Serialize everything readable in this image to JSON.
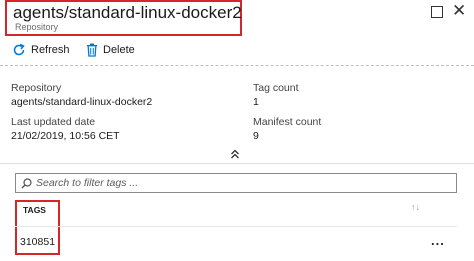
{
  "header": {
    "title": "agents/standard-linux-docker2",
    "subtitle": "Repository"
  },
  "toolbar": {
    "refresh_label": "Refresh",
    "delete_label": "Delete"
  },
  "essentials": {
    "repository_label": "Repository",
    "repository_value": "agents/standard-linux-docker2",
    "last_updated_label": "Last updated date",
    "last_updated_value": "21/02/2019, 10:56 CET",
    "tag_count_label": "Tag count",
    "tag_count_value": "1",
    "manifest_count_label": "Manifest count",
    "manifest_count_value": "9"
  },
  "search": {
    "placeholder": "Search to filter tags ..."
  },
  "table": {
    "columns": [
      "TAGS"
    ],
    "rows": [
      {
        "tag": "310851"
      }
    ]
  },
  "icons": {
    "refresh": "refresh-icon",
    "delete": "trash-icon",
    "search": "search-icon",
    "collapse": "chevron-double-up-icon",
    "sort": "sort-icon",
    "more": "more-icon",
    "restore": "restore-icon",
    "close": "close-icon"
  },
  "colors": {
    "accent": "#0078d4",
    "highlight": "#d6262b"
  }
}
